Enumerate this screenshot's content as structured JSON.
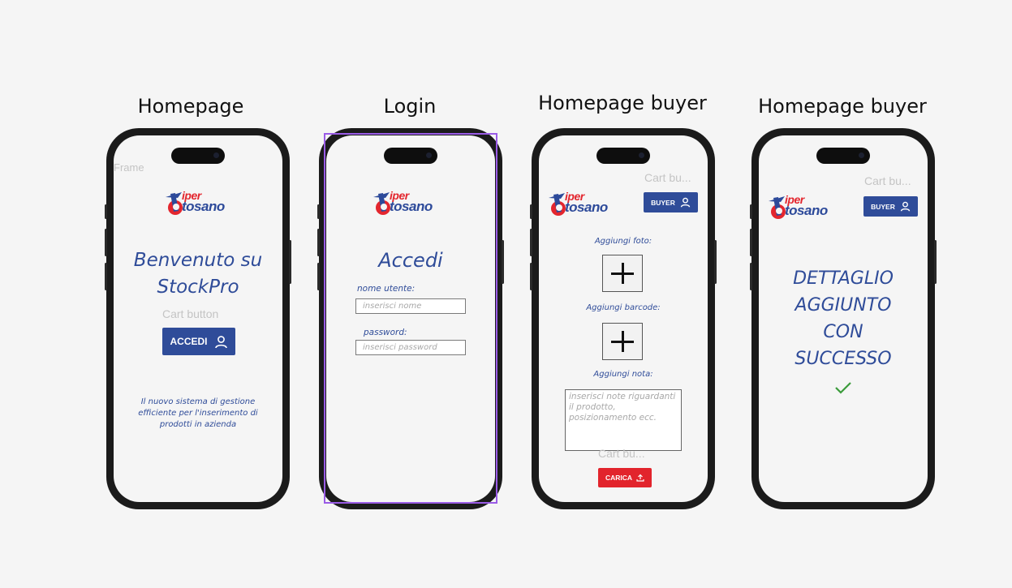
{
  "frames": [
    {
      "title": "Homepage",
      "corner_label": "Frame",
      "headline": "Benvenuto su StockPro",
      "ghost_label": "Cart button",
      "button_label": "ACCEDI",
      "tagline": "Il nuovo sistema di gestione efficiente per l'inserimento di prodotti in azienda"
    },
    {
      "title": "Login",
      "headline": "Accedi",
      "username_label": "nome utente:",
      "username_placeholder": "inserisci nome",
      "password_label": "password:",
      "password_placeholder": "inserisci password"
    },
    {
      "title": "Homepage buyer",
      "ghost_top": "Cart bu...",
      "buyer_label": "BUYER",
      "photo_label": "Aggiungi foto:",
      "barcode_label": "Aggiungi barcode:",
      "note_label": "Aggiungi nota:",
      "note_placeholder": "inserisci note riguardanti il prodotto, posizionamento ecc.",
      "ghost_bottom": "Cart bu...",
      "upload_label": "CARICA"
    },
    {
      "title": "Homepage buyer",
      "ghost_top": "Cart bu...",
      "buyer_label": "BUYER",
      "success_message": "DETTAGLIO AGGIUNTO CON SUCCESSO"
    }
  ],
  "logo": {
    "line1": "iper",
    "line2": "tosano"
  },
  "colors": {
    "brand_blue": "#2f4c99",
    "brand_red": "#e2242c",
    "success_green": "#3a9b3a",
    "selection": "#9a5ce6"
  }
}
